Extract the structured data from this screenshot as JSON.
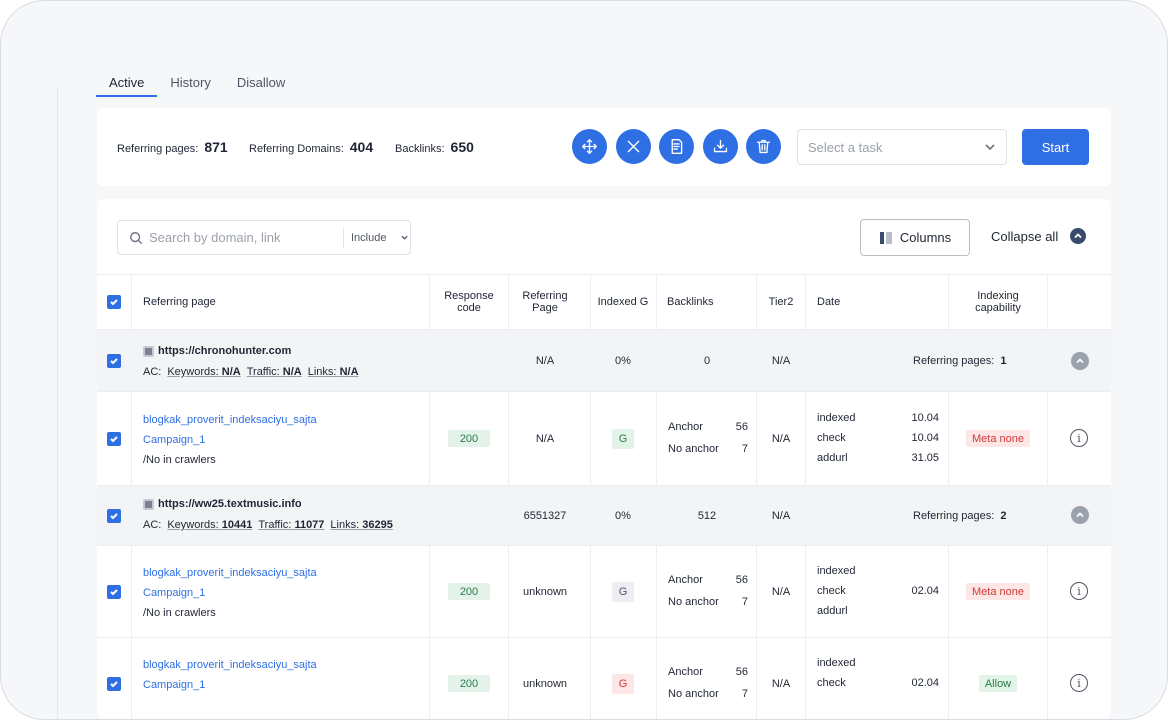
{
  "tabs": [
    {
      "label": "Active"
    },
    {
      "label": "History"
    },
    {
      "label": "Disallow"
    }
  ],
  "stats": {
    "referring_pages_label": "Referring pages:",
    "referring_pages_value": "871",
    "referring_domains_label": "Referring Domains:",
    "referring_domains_value": "404",
    "backlinks_label": "Backlinks:",
    "backlinks_value": "650"
  },
  "toolbar": {
    "icons": [
      "move-icon",
      "close-icon",
      "report-icon",
      "download-icon",
      "trash-icon"
    ],
    "task_placeholder": "Select a task",
    "start_label": "Start"
  },
  "filters": {
    "search_placeholder": "Search by domain, link",
    "include_label": "Include",
    "columns_label": "Columns",
    "collapse_label": "Collapse all"
  },
  "columns": {
    "referring_page": "Referring page",
    "response_code": "Response code",
    "referring_page_col": "Referring Page",
    "indexed_g": "Indexed G",
    "backlinks": "Backlinks",
    "tier2": "Tier2",
    "date": "Date",
    "indexing_capability": "Indexing capability"
  },
  "groups": [
    {
      "domain": "https://chronohunter.com",
      "ac_label": "AC:",
      "keywords_label": "Keywords:",
      "keywords": "N/A",
      "traffic_label": "Traffic:",
      "traffic": "N/A",
      "links_label": "Links:",
      "links": "N/A",
      "referring_page": "N/A",
      "indexed": "0%",
      "backlinks": "0",
      "tier2": "N/A",
      "ref_pages_label": "Referring pages:",
      "ref_pages_count": "1"
    },
    {
      "domain": "https://ww25.textmusic.info",
      "ac_label": "AC:",
      "keywords_label": "Keywords:",
      "keywords": "10441",
      "traffic_label": "Traffic:",
      "traffic": "11077",
      "links_label": "Links:",
      "links": "36295",
      "referring_page": "6551327",
      "indexed": "0%",
      "backlinks": "512",
      "tier2": "N/A",
      "ref_pages_label": "Referring pages:",
      "ref_pages_count": "2"
    }
  ],
  "pages": [
    {
      "link": "blogkak_proverit_indeksaciyu_sajta",
      "campaign": "Campaign_1",
      "note": "/No in crawlers",
      "response": "200",
      "referring_page": "N/A",
      "indexed_g": "G",
      "anchor_label": "Anchor",
      "anchor": "56",
      "no_anchor_label": "No anchor",
      "no_anchor": "7",
      "tier2": "N/A",
      "d1_label": "indexed",
      "d1": "10.04",
      "d2_label": "check",
      "d2": "10.04",
      "d3_label": "addurl",
      "d3": "31.05",
      "capability": "Meta none"
    },
    {
      "link": "blogkak_proverit_indeksaciyu_sajta",
      "campaign": "Campaign_1",
      "note": "/No in crawlers",
      "response": "200",
      "referring_page": "unknown",
      "indexed_g": "G",
      "anchor_label": "Anchor",
      "anchor": "56",
      "no_anchor_label": "No anchor",
      "no_anchor": "7",
      "tier2": "N/A",
      "d1_label": "indexed",
      "d1": "",
      "d2_label": "check",
      "d2": "02.04",
      "d3_label": "addurl",
      "d3": "",
      "capability": "Meta none"
    },
    {
      "link": "blogkak_proverit_indeksaciyu_sajta",
      "campaign": "Campaign_1",
      "response": "200",
      "referring_page": "unknown",
      "indexed_g": "G",
      "anchor_label": "Anchor",
      "anchor": "56",
      "no_anchor_label": "No anchor",
      "no_anchor": "7",
      "tier2": "N/A",
      "d1_label": "indexed",
      "d1": "",
      "d2_label": "check",
      "d2": "02.04",
      "capability": "Allow"
    }
  ]
}
